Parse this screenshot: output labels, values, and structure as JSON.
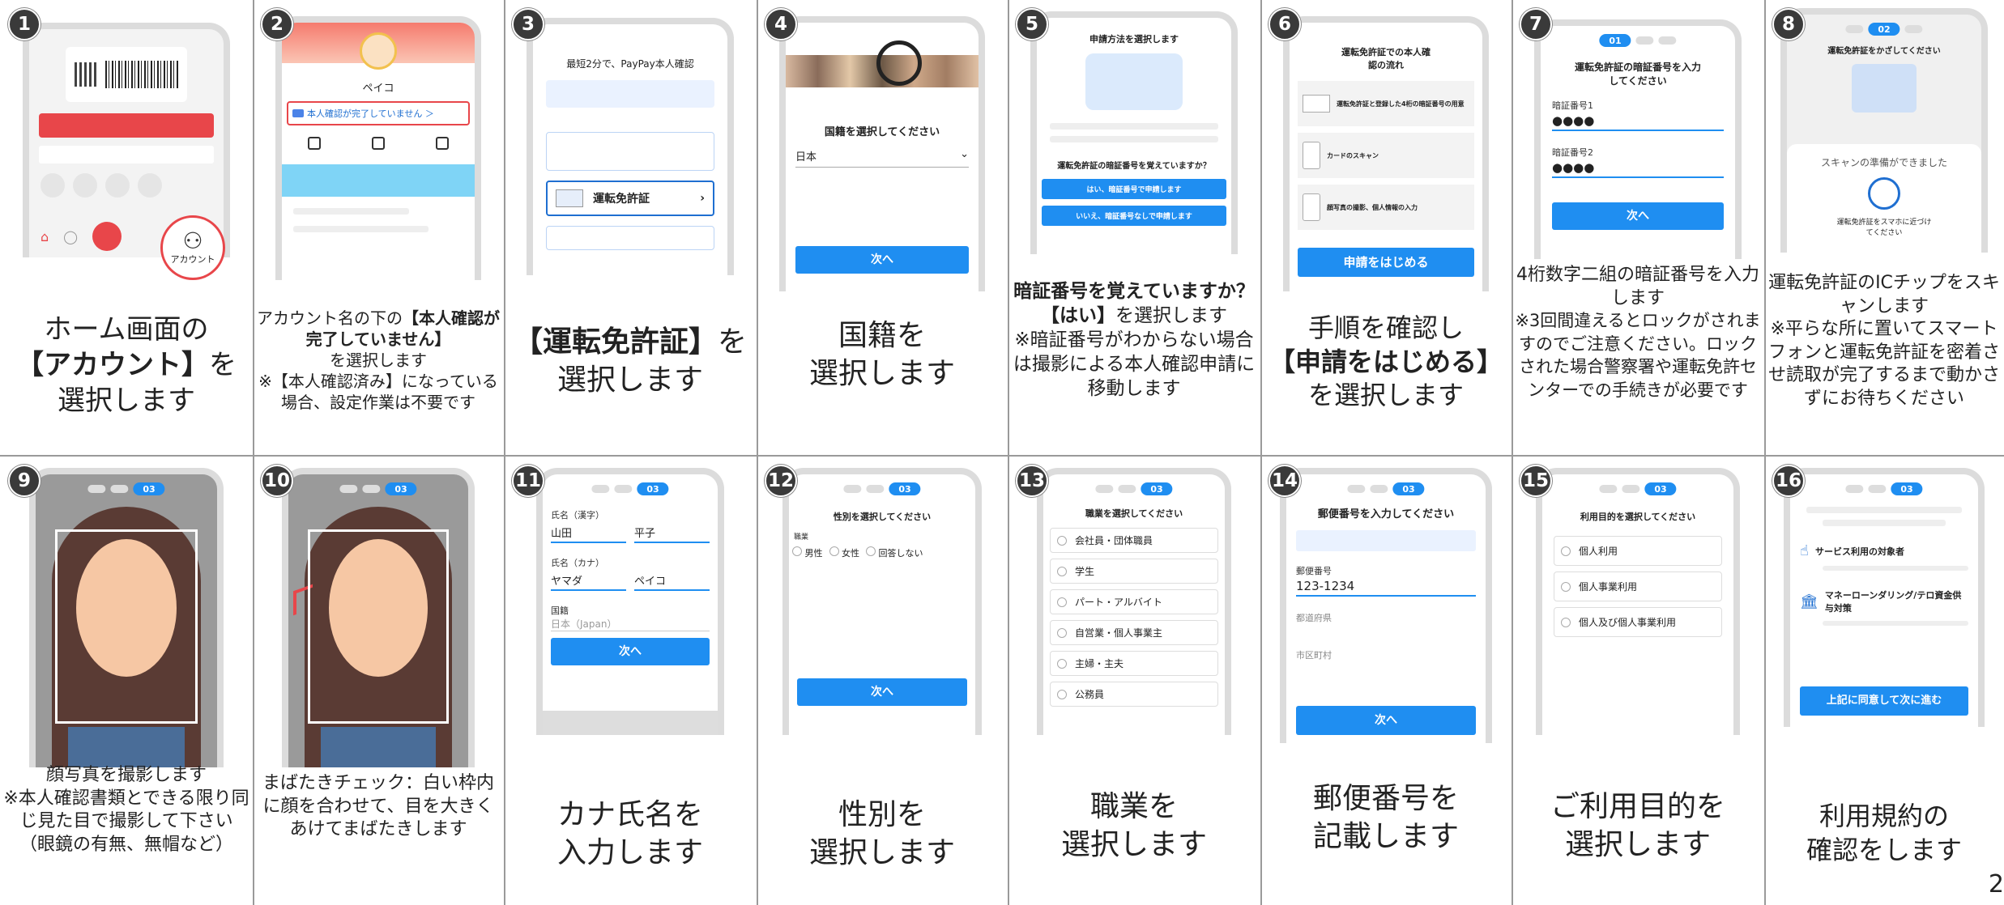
{
  "steps": [
    {
      "num": "1",
      "ui": {
        "account_label": "アカウント"
      },
      "caption": [
        "ホーム画面の",
        "【アカウント】",
        "を",
        "選択します"
      ]
    },
    {
      "num": "2",
      "ui": {
        "user": "ペイコ",
        "banner": "本人確認が完了していません ＞"
      },
      "caption": [
        "アカウント名の下の",
        "【本人確認が完了していません】",
        "を選択します",
        "※【本人確認済み】になっている場合、設定作業は不要です"
      ]
    },
    {
      "num": "3",
      "ui": {
        "intro": "最短2分で、PayPay本人確認",
        "option": "運転免許証"
      },
      "caption": [
        "【運転免許証】",
        "を選択します"
      ]
    },
    {
      "num": "4",
      "ui": {
        "question": "国籍を選択してください",
        "value": "日本",
        "button": "次へ"
      },
      "caption": [
        "国籍を",
        "選択します"
      ]
    },
    {
      "num": "5",
      "ui": {
        "title": "申請方法を選択します",
        "question": "運転免許証の暗証番号を覚えていますか？",
        "yes": "はい、暗証番号で申請します",
        "no": "いいえ、暗証番号なしで申請します"
      },
      "caption": [
        "暗証番号を覚えていますか？【はい】",
        "を選択します",
        "※暗証番号がわからない場合は撮影による本人確認申請に移動します"
      ]
    },
    {
      "num": "6",
      "ui": {
        "title": "運転免許証での本人確認の流れ",
        "s1": "運転免許証と登録した4桁の暗証番号の用意",
        "s2": "カードのスキャン",
        "s3": "顔写真の撮影、個人情報の入力",
        "button": "申請をはじめる"
      },
      "caption": [
        "手順を確認し",
        "【申請をはじめる】",
        "を選択します"
      ]
    },
    {
      "num": "7",
      "ui": {
        "step": "01",
        "title": "運転免許証の暗証番号を入力してください",
        "l1": "暗証番号1",
        "v1": "●●●●",
        "l2": "暗証番号2",
        "v2": "●●●●",
        "button": "次へ"
      },
      "caption": [
        "4桁数字二組の暗証番号を入力します",
        "※3回間違えるとロックがされますのでご注意ください。ロックされた場合警察署や運転免許センターでの手続きが必要です"
      ]
    },
    {
      "num": "8",
      "ui": {
        "step": "02",
        "title": "運転免許証をかざしてください",
        "ready": "スキャンの準備ができました",
        "hint": "運転免許証をスマホに近づけてください"
      },
      "caption": [
        "運転免許証のICチップをスキャンします",
        "※平らな所に置いてスマートフォンと運転免許証を密着させ読取が完了するまで動かさずにお待ちください"
      ]
    },
    {
      "num": "9",
      "ui": {
        "step": "03"
      },
      "caption": [
        "顔写真を撮影します",
        "※本人確認書類とできる限り同じ見た目で撮影して下さい（眼鏡の有無、無帽など）"
      ]
    },
    {
      "num": "10",
      "ui": {
        "step": "03"
      },
      "caption": [
        "まばたきチェック：白い枠内に顔を合わせて、目を大きくあけてまばたきします"
      ]
    },
    {
      "num": "11",
      "ui": {
        "step": "03",
        "l1": "氏名（漢字）",
        "last": "山田",
        "first": "平子",
        "l2": "氏名（カナ）",
        "klast": "ヤマダ",
        "kfirst": "ペイコ",
        "l3": "国籍",
        "nat": "日本（Japan）",
        "button": "次へ"
      },
      "caption": [
        "カナ氏名を",
        "入力します"
      ]
    },
    {
      "num": "12",
      "ui": {
        "step": "03",
        "title": "性別を選択してください",
        "sub": "職業",
        "o1": "男性",
        "o2": "女性",
        "o3": "回答しない",
        "button": "次へ"
      },
      "caption": [
        "性別を",
        "選択します"
      ]
    },
    {
      "num": "13",
      "ui": {
        "step": "03",
        "title": "職業を選択してください",
        "options": [
          "会社員・団体職員",
          "学生",
          "パート・アルバイト",
          "自営業・個人事業主",
          "主婦・主夫",
          "公務員"
        ]
      },
      "caption": [
        "職業を",
        "選択します"
      ]
    },
    {
      "num": "14",
      "ui": {
        "step": "03",
        "title": "郵便番号を入力してください",
        "l1": "郵便番号",
        "v1": "123-1234",
        "l2": "都道府県",
        "l3": "市区町村",
        "button": "次へ"
      },
      "caption": [
        "郵便番号を",
        "記載します"
      ]
    },
    {
      "num": "15",
      "ui": {
        "step": "03",
        "title": "利用目的を選択してください",
        "options": [
          "個人利用",
          "個人事業利用",
          "個人及び個人事業利用"
        ]
      },
      "caption": [
        "ご利用目的を",
        "選択します"
      ]
    },
    {
      "num": "16",
      "ui": {
        "step": "03",
        "t1": "サービス利用の対象者",
        "t2": "マネーローンダリング/テロ資金供与対策",
        "button": "上記に同意して次に進む"
      },
      "caption": [
        "利用規約の",
        "確認をします"
      ]
    }
  ],
  "page_number": "2",
  "colors": {
    "accent": "#1f8ef1",
    "red": "#e8464a",
    "badge": "#3a3a3a"
  }
}
